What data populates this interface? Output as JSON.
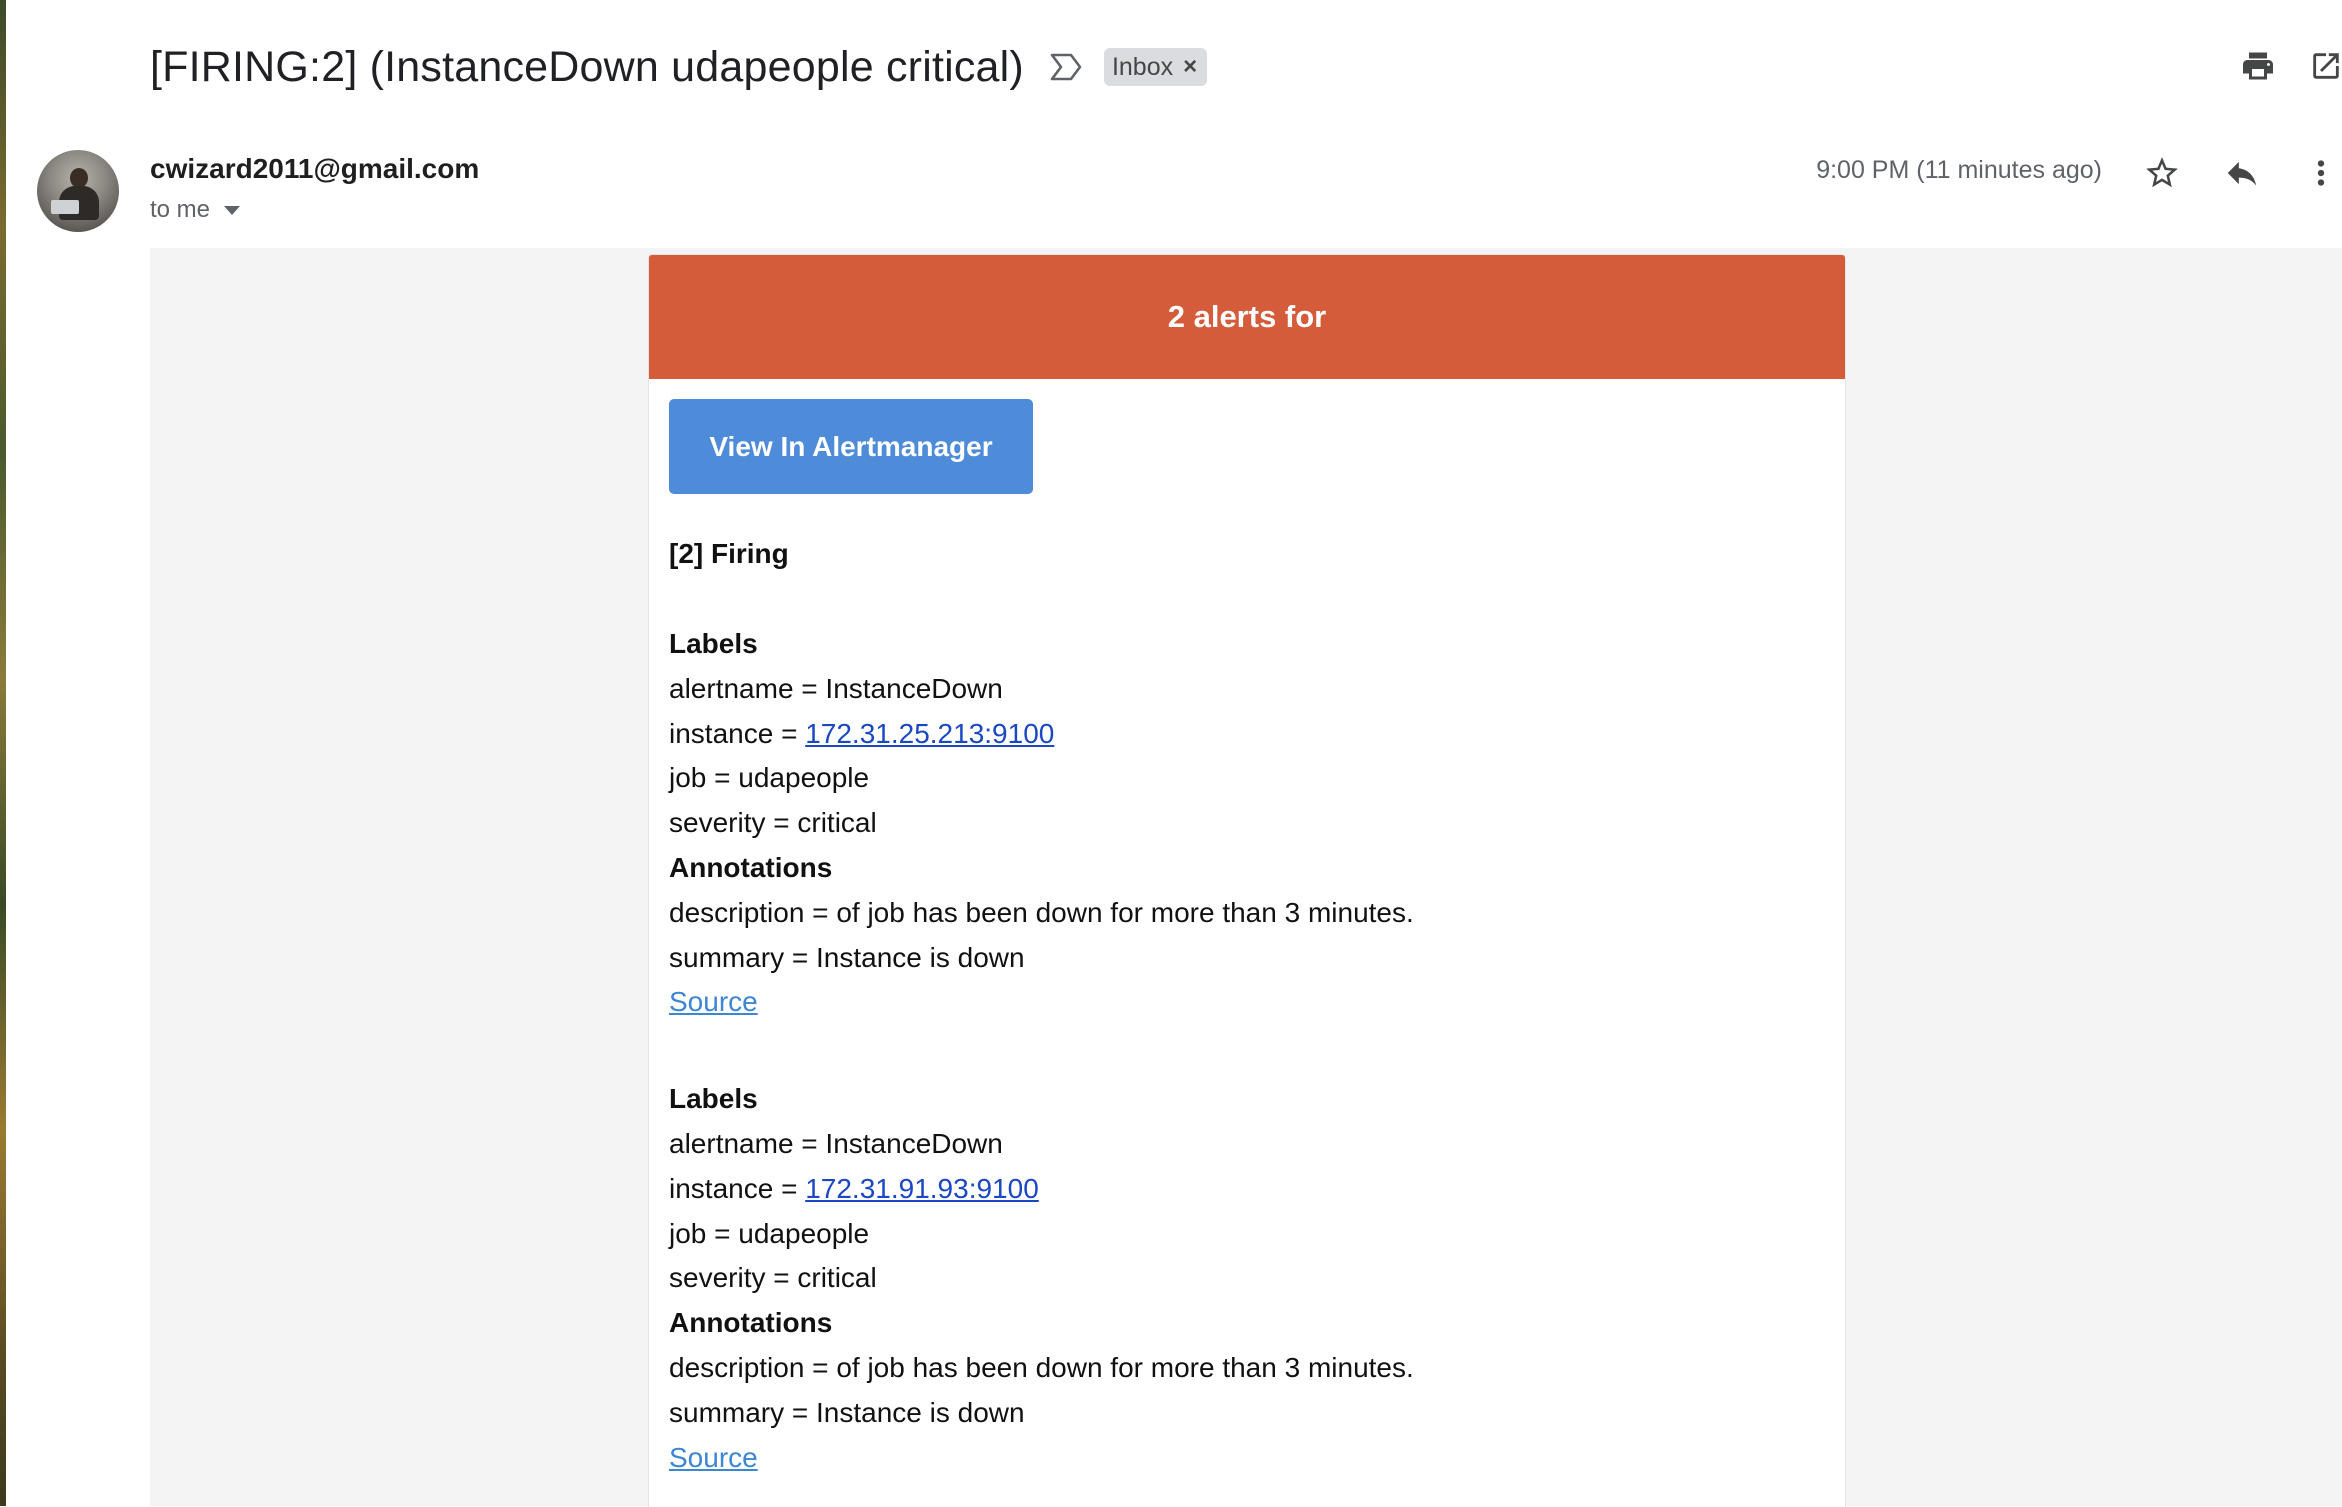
{
  "email": {
    "subject": "[FIRING:2] (InstanceDown udapeople critical)",
    "label_chip": "Inbox",
    "label_chip_remove": "×",
    "sender": "cwizard2011@gmail.com",
    "recipient": "to me",
    "time": "9:00 PM (11 minutes ago)"
  },
  "icons": {
    "importance": "importance-marker-icon",
    "print": "print-icon",
    "popout": "open-in-new-window-icon",
    "star": "star-icon",
    "reply": "reply-icon",
    "more": "more-vert-icon",
    "dropdown": "caret-down-icon"
  },
  "colors": {
    "alert_header": "#d55c3b",
    "button": "#4e8cd9",
    "link": "#1a47c4",
    "source_link": "#3d86d4",
    "chip": "#dadce0"
  },
  "alert": {
    "header": "2 alerts for",
    "button_label": "View In Alertmanager",
    "firing_title": "[2] Firing",
    "alerts": [
      {
        "labels_heading": "Labels",
        "alertname": "alertname = InstanceDown",
        "instance_prefix": "instance = ",
        "instance_link": "172.31.25.213:9100",
        "job": "job = udapeople",
        "severity": "severity = critical",
        "annotations_heading": "Annotations",
        "description": "description = of job has been down for more than 3 minutes.",
        "summary": "summary = Instance is down",
        "source": "Source"
      },
      {
        "labels_heading": "Labels",
        "alertname": "alertname = InstanceDown",
        "instance_prefix": "instance = ",
        "instance_link": "172.31.91.93:9100",
        "job": "job = udapeople",
        "severity": "severity = critical",
        "annotations_heading": "Annotations",
        "description": "description = of job has been down for more than 3 minutes.",
        "summary": "summary = Instance is down",
        "source": "Source"
      }
    ]
  }
}
